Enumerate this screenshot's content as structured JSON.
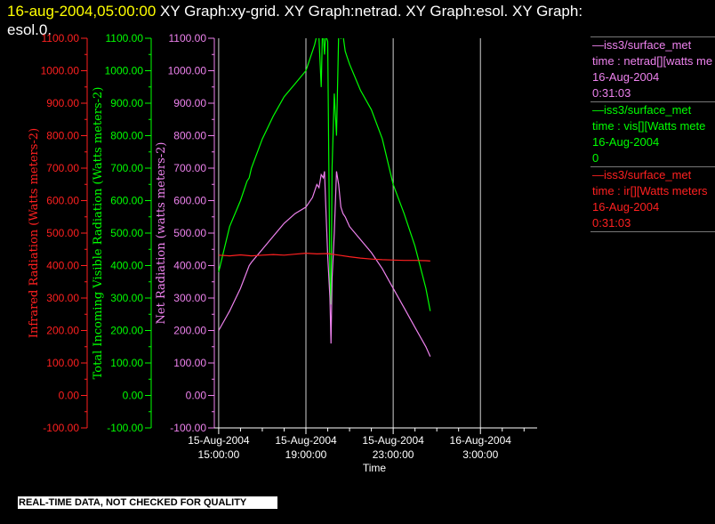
{
  "header": {
    "date": "16-aug-2004,05:00:00",
    "text": "XY Graph:xy-grid.  XY Graph:netrad.  XY Graph:esol.  XY Graph:",
    "text2": "esol.0."
  },
  "legend": [
    {
      "line1": "iss3/surface_met",
      "line2": "time : netrad[][watts me",
      "line3": "16-Aug-2004",
      "line4": "0:31:03",
      "color": "#ee82ee"
    },
    {
      "line1": "iss3/surface_met",
      "line2": "time : vis[][Watts mete",
      "line3": "16-Aug-2004",
      "line4": "0",
      "color": "#00ff00"
    },
    {
      "line1": "iss3/surface_met",
      "line2": "time : ir[][Watts meters",
      "line3": "16-Aug-2004",
      "line4": "0:31:03",
      "color": "#ff2020"
    }
  ],
  "footer": {
    "qc_notice": "REAL-TIME DATA, NOT CHECKED FOR QUALITY"
  },
  "chart_data": {
    "type": "line",
    "xlabel": "Time",
    "x_ticks": [
      {
        "line1": "15-Aug-2004",
        "line2": "15:00:00",
        "t": 0
      },
      {
        "line1": "15-Aug-2004",
        "line2": "19:00:00",
        "t": 4
      },
      {
        "line1": "15-Aug-2004",
        "line2": "23:00:00",
        "t": 8
      },
      {
        "line1": "16-Aug-2004",
        "line2": "3:00:00",
        "t": 12
      }
    ],
    "xlim_hours_after_15_aug_15_00": [
      -0.2,
      14.6
    ],
    "grid": "vertical lines at major x ticks",
    "axes": [
      {
        "id": "ir",
        "label": "Infrared Radiation (Watts meters-2)",
        "color": "#ff2020",
        "ylim": [
          -100,
          1100
        ],
        "ticks": [
          "1100.00",
          "1000.00",
          "900.00",
          "800.00",
          "700.00",
          "600.00",
          "500.00",
          "400.00",
          "300.00",
          "200.00",
          "100.00",
          "0.00",
          "-100.00"
        ]
      },
      {
        "id": "vis",
        "label": "Total Incoming Visible Radiation (Watts meters-2)",
        "color": "#00ff00",
        "ylim": [
          -100,
          1100
        ],
        "ticks": [
          "1100.00",
          "1000.00",
          "900.00",
          "800.00",
          "700.00",
          "600.00",
          "500.00",
          "400.00",
          "300.00",
          "200.00",
          "100.00",
          "0.00",
          "-100.00"
        ]
      },
      {
        "id": "netrad",
        "label": "Net Radiation (watts meters-2)",
        "color": "#ee82ee",
        "ylim": [
          -100,
          1100
        ],
        "ticks": [
          "1100.00",
          "1000.00",
          "900.00",
          "800.00",
          "700.00",
          "600.00",
          "500.00",
          "400.00",
          "300.00",
          "200.00",
          "100.00",
          "0.00",
          "-100.00"
        ]
      }
    ],
    "series": [
      {
        "axis": "vis",
        "color": "#00ff00",
        "t": [
          0,
          0.5,
          1.0,
          1.3,
          1.4,
          1.5,
          2.0,
          2.5,
          3.0,
          3.5,
          4.0,
          4.3,
          4.4,
          4.5,
          4.6,
          4.7,
          4.75,
          4.8,
          4.85,
          4.9,
          5.0,
          5.1,
          5.15,
          5.2,
          5.3,
          5.4,
          5.5,
          5.6,
          5.7,
          5.8,
          5.9,
          6.0,
          6.5,
          7.0,
          7.5,
          8.0,
          8.5,
          9.0,
          9.5,
          9.7
        ],
        "values": [
          380,
          520,
          600,
          660,
          670,
          700,
          790,
          860,
          920,
          960,
          1000,
          1060,
          1080,
          1110,
          1100,
          950,
          1100,
          1110,
          1050,
          1110,
          1090,
          350,
          280,
          700,
          930,
          800,
          1110,
          1100,
          1110,
          1060,
          1040,
          1020,
          940,
          880,
          790,
          650,
          560,
          460,
          330,
          260
        ]
      },
      {
        "axis": "netrad",
        "color": "#ee82ee",
        "t": [
          0,
          0.5,
          1.0,
          1.4,
          1.5,
          2.0,
          2.5,
          3.0,
          3.5,
          4.0,
          4.3,
          4.5,
          4.6,
          4.7,
          4.8,
          4.85,
          4.9,
          5.0,
          5.1,
          5.15,
          5.2,
          5.3,
          5.4,
          5.5,
          5.6,
          5.7,
          5.8,
          6.0,
          6.5,
          7.0,
          7.5,
          8.0,
          8.5,
          9.0,
          9.5,
          9.7
        ],
        "values": [
          200,
          260,
          330,
          400,
          410,
          450,
          490,
          530,
          560,
          580,
          610,
          650,
          640,
          680,
          670,
          690,
          600,
          430,
          300,
          160,
          360,
          500,
          690,
          650,
          580,
          560,
          550,
          520,
          480,
          440,
          390,
          330,
          270,
          210,
          150,
          120
        ]
      },
      {
        "axis": "ir",
        "color": "#ff2020",
        "t": [
          0,
          0.5,
          1.0,
          1.5,
          2.0,
          2.5,
          3.0,
          3.5,
          4.0,
          4.5,
          5.0,
          5.5,
          6.0,
          6.5,
          7.0,
          7.5,
          8.0,
          8.5,
          9.0,
          9.5,
          9.7
        ],
        "values": [
          432,
          430,
          433,
          430,
          432,
          434,
          432,
          435,
          438,
          436,
          437,
          432,
          427,
          423,
          420,
          418,
          417,
          416,
          416,
          415,
          414
        ]
      }
    ]
  }
}
